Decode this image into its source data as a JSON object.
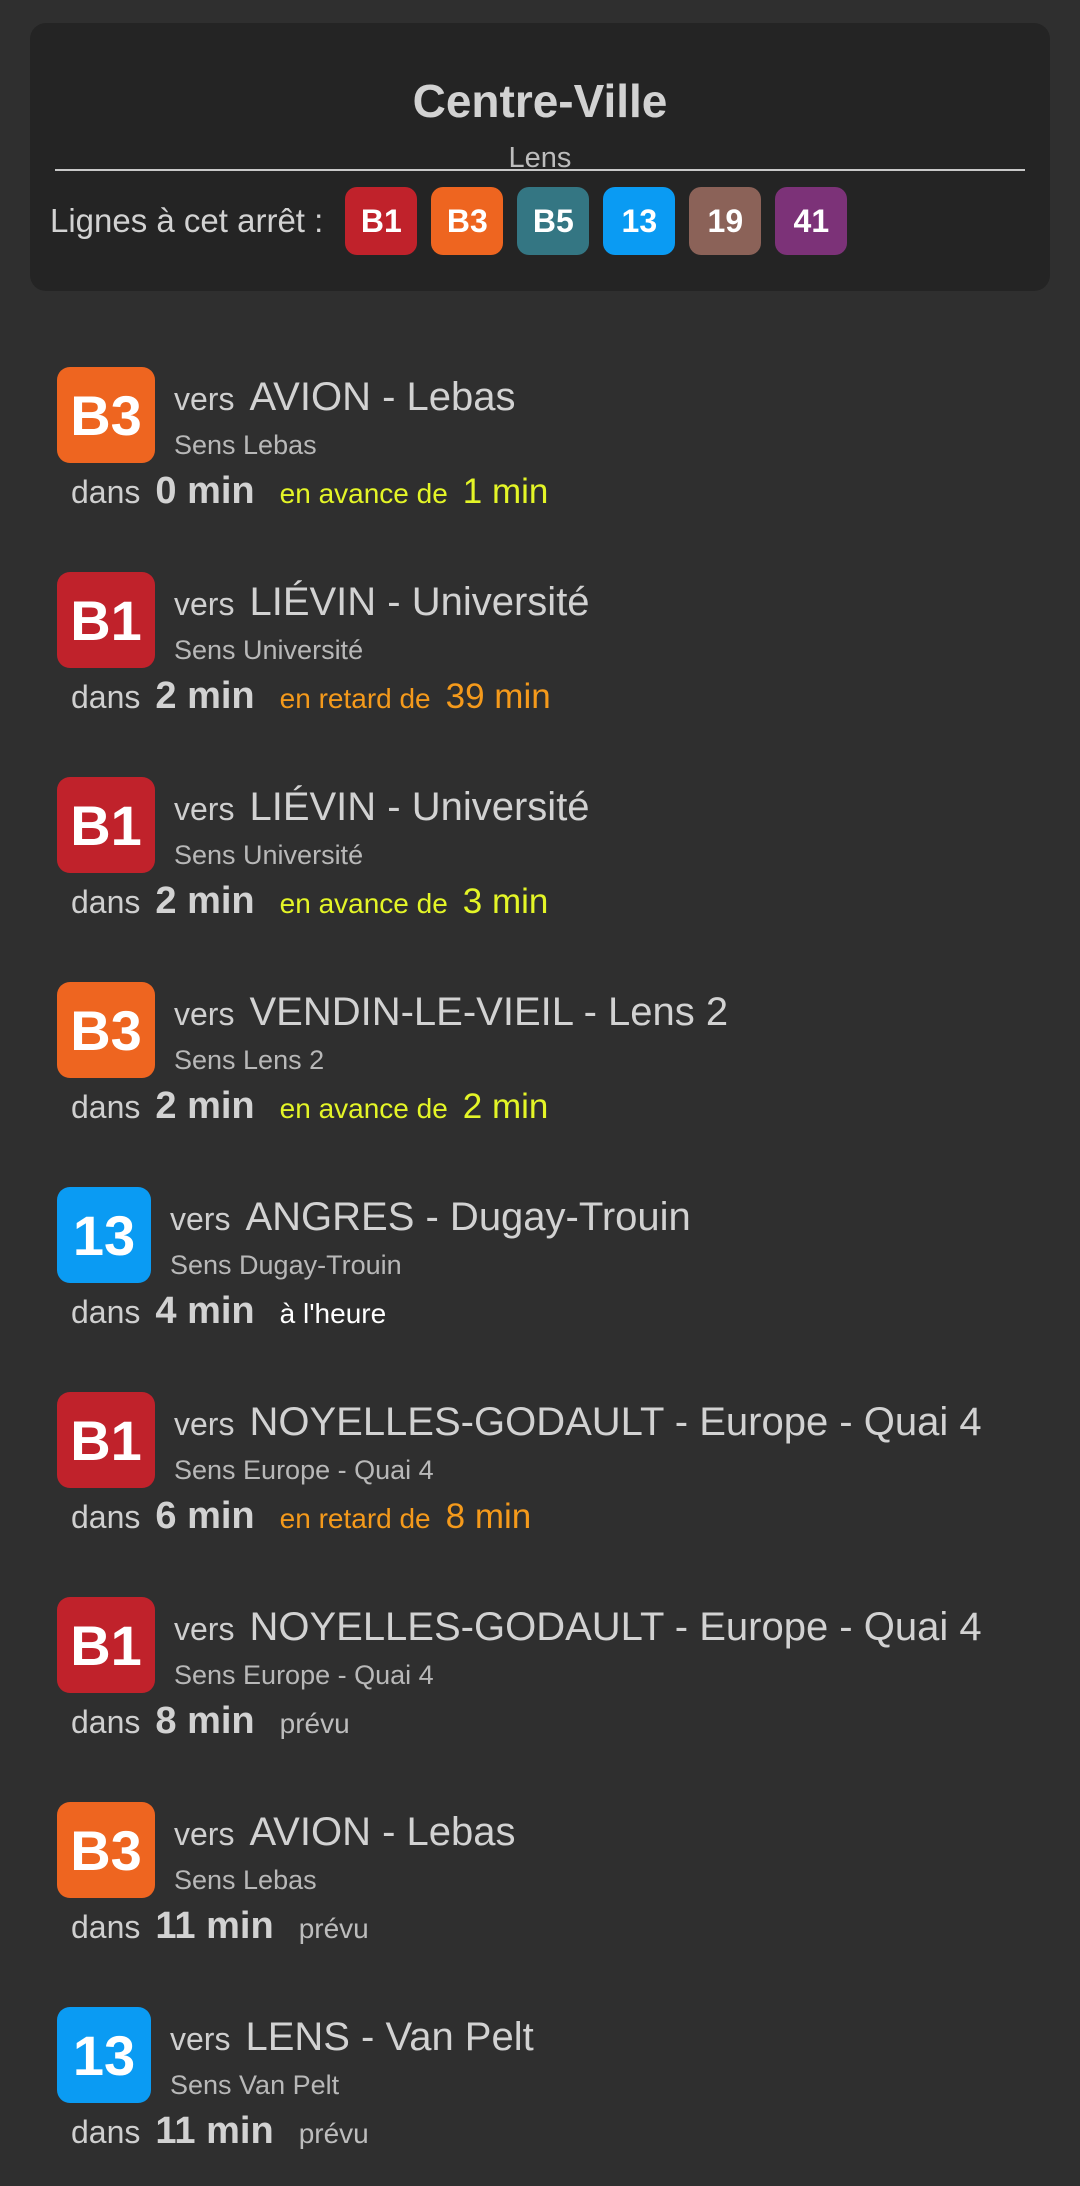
{
  "stop": {
    "name": "Centre-Ville",
    "city": "Lens",
    "lines_label": "Lignes à cet arrêt :",
    "lines": [
      {
        "label": "B1",
        "color": "#c0222b"
      },
      {
        "label": "B3",
        "color": "#ee6520"
      },
      {
        "label": "B5",
        "color": "#347683"
      },
      {
        "label": "13",
        "color": "#0a9bf3"
      },
      {
        "label": "19",
        "color": "#8b6258"
      },
      {
        "label": "41",
        "color": "#7c3278"
      }
    ]
  },
  "labels": {
    "vers": "vers",
    "dans": "dans"
  },
  "colors": {
    "background": "#2f2f2f",
    "card": "#242424",
    "early": "#e4f527",
    "late": "#f59a1b",
    "ontime": "#ffffff",
    "planned": "#bdbdbd"
  },
  "departures": [
    {
      "line": "B3",
      "line_color": "#ee6520",
      "destination": "AVION - Lebas",
      "sens": "Sens Lebas",
      "minutes": "0 min",
      "status": "en avance de",
      "status_type": "early",
      "offset": "1 min"
    },
    {
      "line": "B1",
      "line_color": "#c0222b",
      "destination": "LIÉVIN - Université",
      "sens": "Sens Université",
      "minutes": "2 min",
      "status": "en retard de",
      "status_type": "late",
      "offset": "39 min"
    },
    {
      "line": "B1",
      "line_color": "#c0222b",
      "destination": "LIÉVIN - Université",
      "sens": "Sens Université",
      "minutes": "2 min",
      "status": "en avance de",
      "status_type": "early",
      "offset": "3 min"
    },
    {
      "line": "B3",
      "line_color": "#ee6520",
      "destination": "VENDIN-LE-VIEIL - Lens 2",
      "sens": "Sens Lens 2",
      "minutes": "2 min",
      "status": "en avance de",
      "status_type": "early",
      "offset": "2 min"
    },
    {
      "line": "13",
      "line_color": "#0a9bf3",
      "destination": "ANGRES - Dugay-Trouin",
      "sens": "Sens Dugay-Trouin",
      "minutes": "4 min",
      "status": "à l'heure",
      "status_type": "ontime",
      "offset": ""
    },
    {
      "line": "B1",
      "line_color": "#c0222b",
      "destination": "NOYELLES-GODAULT - Europe - Quai 4",
      "sens": "Sens Europe - Quai 4",
      "minutes": "6 min",
      "status": "en retard de",
      "status_type": "late",
      "offset": "8 min"
    },
    {
      "line": "B1",
      "line_color": "#c0222b",
      "destination": "NOYELLES-GODAULT - Europe - Quai 4",
      "sens": "Sens Europe - Quai 4",
      "minutes": "8 min",
      "status": "prévu",
      "status_type": "planned",
      "offset": ""
    },
    {
      "line": "B3",
      "line_color": "#ee6520",
      "destination": "AVION - Lebas",
      "sens": "Sens Lebas",
      "minutes": "11 min",
      "status": "prévu",
      "status_type": "planned",
      "offset": ""
    },
    {
      "line": "13",
      "line_color": "#0a9bf3",
      "destination": "LENS - Van Pelt",
      "sens": "Sens Van Pelt",
      "minutes": "11 min",
      "status": "prévu",
      "status_type": "planned",
      "offset": ""
    }
  ]
}
